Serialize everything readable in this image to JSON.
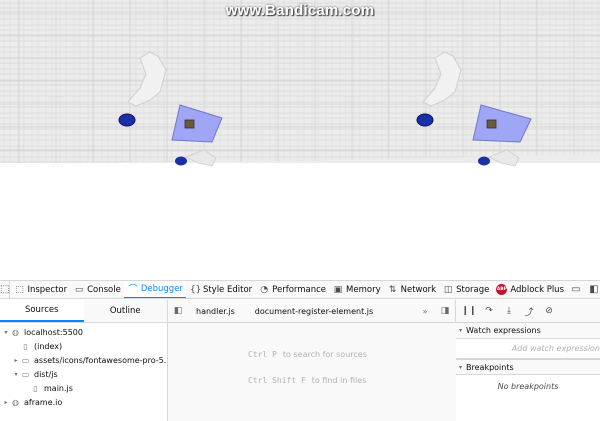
{
  "watermark": "www.Bandicam.com",
  "devtools": {
    "tabs": [
      {
        "icon": "inspector-icon",
        "glyph": "⬚",
        "label": "Inspector",
        "active": false
      },
      {
        "icon": "console-icon",
        "glyph": "▭",
        "label": "Console",
        "active": false
      },
      {
        "icon": "debugger-icon",
        "glyph": "⌒",
        "label": "Debugger",
        "active": true
      },
      {
        "icon": "style-editor-icon",
        "glyph": "{}",
        "label": "Style Editor",
        "active": false
      },
      {
        "icon": "performance-icon",
        "glyph": "◔",
        "label": "Performance",
        "active": false
      },
      {
        "icon": "memory-icon",
        "glyph": "▣",
        "label": "Memory",
        "active": false
      },
      {
        "icon": "network-icon",
        "glyph": "⇅",
        "label": "Network",
        "active": false
      },
      {
        "icon": "storage-icon",
        "glyph": "◫",
        "label": "Storage",
        "active": false
      },
      {
        "icon": "adblock-icon",
        "glyph": "ABP",
        "label": "Adblock Plus",
        "active": false
      }
    ],
    "sources_panel": {
      "tabs": [
        "Sources",
        "Outline"
      ],
      "tree": [
        {
          "label": "localhost:5500",
          "indent": 0,
          "arrow": "▾",
          "icon": "globe"
        },
        {
          "label": "(index)",
          "indent": 1,
          "arrow": "",
          "icon": "file"
        },
        {
          "label": "assets/icons/fontawesome-pro-5.",
          "indent": 1,
          "arrow": "▸",
          "icon": "folder"
        },
        {
          "label": "dist/js",
          "indent": 1,
          "arrow": "▾",
          "icon": "folder"
        },
        {
          "label": "main.js",
          "indent": 2,
          "arrow": "",
          "icon": "file"
        },
        {
          "label": "aframe.io",
          "indent": 0,
          "arrow": "▸",
          "icon": "globe"
        }
      ]
    },
    "editor": {
      "open_files": [
        "handler.js",
        "document-register-element.js"
      ],
      "hint1_keys": "Ctrl P",
      "hint1_text": "to search for sources",
      "hint2_keys": "Ctrl Shift F",
      "hint2_text": "to find in files"
    },
    "side_panel": {
      "watch_label": "Watch expressions",
      "watch_placeholder": "Add watch expression",
      "breakpoints_label": "Breakpoints",
      "no_breakpoints": "No breakpoints"
    }
  }
}
